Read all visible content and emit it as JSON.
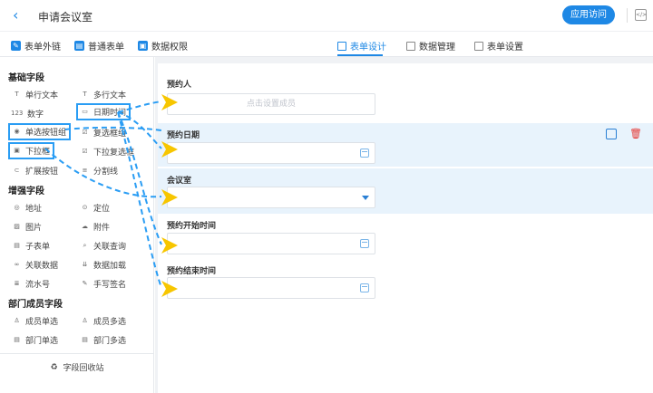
{
  "header": {
    "back_icon": "‹",
    "title": "申请会议室",
    "app_button": "应用访问",
    "code_icon": "</>"
  },
  "toolbar": {
    "left_items": [
      {
        "label": "表单外链",
        "icon": "link-icon"
      },
      {
        "label": "普通表单",
        "icon": "form-icon"
      },
      {
        "label": "数据权限",
        "icon": "permission-icon"
      }
    ],
    "tabs": [
      {
        "label": "表单设计",
        "icon": "design-icon",
        "active": true
      },
      {
        "label": "数据管理",
        "icon": "data-icon",
        "active": false
      },
      {
        "label": "表单设置",
        "icon": "settings-icon",
        "active": false
      }
    ]
  },
  "sidebar": {
    "sections": [
      {
        "title": "基础字段"
      },
      {
        "title": "增强字段"
      },
      {
        "title": "部门成员字段"
      }
    ],
    "fields": [
      {
        "label": "单行文本",
        "icon": "T"
      },
      {
        "label": "多行文本",
        "icon": "T"
      },
      {
        "label": "数字",
        "icon": "123"
      },
      {
        "label": "日期时间",
        "icon": "▭"
      },
      {
        "label": "单选按钮组",
        "icon": "◉"
      },
      {
        "label": "复选框组",
        "icon": "☑"
      },
      {
        "label": "下拉框",
        "icon": "▣"
      },
      {
        "label": "下拉复选框",
        "icon": "☑"
      },
      {
        "label": "扩展按钮",
        "icon": "⊂"
      },
      {
        "label": "分割线",
        "icon": "≡"
      },
      {
        "label": "地址",
        "icon": "◎"
      },
      {
        "label": "定位",
        "icon": "⊙"
      },
      {
        "label": "图片",
        "icon": "▨"
      },
      {
        "label": "附件",
        "icon": "☁"
      },
      {
        "label": "子表单",
        "icon": "▤"
      },
      {
        "label": "关联查询",
        "icon": "⌕"
      },
      {
        "label": "关联数据",
        "icon": "∞"
      },
      {
        "label": "数据加载",
        "icon": "⇊"
      },
      {
        "label": "流水号",
        "icon": "≣"
      },
      {
        "label": "手写签名",
        "icon": "✎"
      },
      {
        "label": "成员单选",
        "icon": "♙"
      },
      {
        "label": "成员多选",
        "icon": "♙"
      },
      {
        "label": "部门单选",
        "icon": "▤"
      },
      {
        "label": "部门多选",
        "icon": "▤"
      }
    ],
    "recycle": "字段回收站",
    "recycle_icon": "♻"
  },
  "form": {
    "fields": [
      {
        "label": "预约人",
        "placeholder": "点击设置成员"
      },
      {
        "label": "预约日期",
        "placeholder": ""
      },
      {
        "label": "会议室",
        "placeholder": ""
      },
      {
        "label": "预约开始时间",
        "placeholder": ""
      },
      {
        "label": "预约结束时间",
        "placeholder": ""
      }
    ],
    "delete_icon": "🗑"
  },
  "colors": {
    "accent": "#1e88e5",
    "highlight": "#2a9df4",
    "arrow": "#f7c600",
    "selected_bg": "#e8f3fc",
    "delete": "#e53935"
  }
}
